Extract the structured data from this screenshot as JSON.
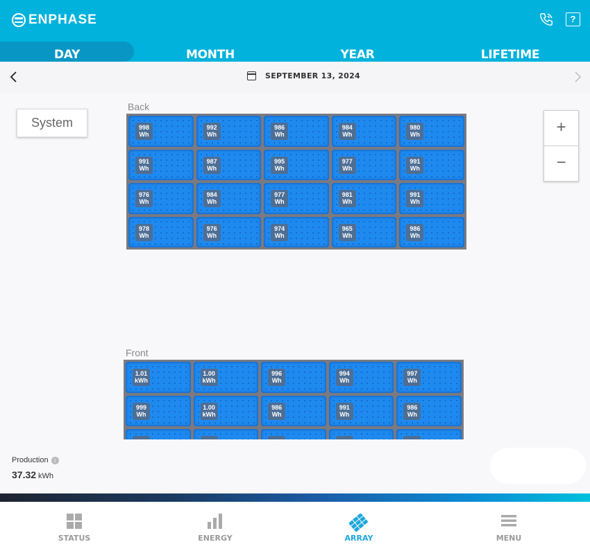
{
  "header": {
    "brand": "ENPHASE",
    "phone_icon": "phone-icon",
    "help_icon": "help-icon",
    "help_glyph": "?"
  },
  "tabs": [
    {
      "label": "DAY",
      "active": true
    },
    {
      "label": "MONTH",
      "active": false
    },
    {
      "label": "YEAR",
      "active": false
    },
    {
      "label": "LIFETIME",
      "active": false
    }
  ],
  "datebar": {
    "date": "SEPTEMBER 13, 2024",
    "prev_icon": "chevron-left-icon",
    "next_icon": "chevron-right-icon",
    "calendar_icon": "calendar-icon"
  },
  "view": {
    "system_button": "System",
    "zoom_in": "+",
    "zoom_out": "−"
  },
  "arrays": {
    "back": {
      "label": "Back",
      "rows": [
        [
          [
            "998",
            "Wh"
          ],
          [
            "992",
            "Wh"
          ],
          [
            "986",
            "Wh"
          ],
          [
            "984",
            "Wh"
          ],
          [
            "980",
            "Wh"
          ]
        ],
        [
          [
            "991",
            "Wh"
          ],
          [
            "987",
            "Wh"
          ],
          [
            "995",
            "Wh"
          ],
          [
            "977",
            "Wh"
          ],
          [
            "991",
            "Wh"
          ]
        ],
        [
          [
            "976",
            "Wh"
          ],
          [
            "984",
            "Wh"
          ],
          [
            "977",
            "Wh"
          ],
          [
            "981",
            "Wh"
          ],
          [
            "991",
            "Wh"
          ]
        ],
        [
          [
            "978",
            "Wh"
          ],
          [
            "976",
            "Wh"
          ],
          [
            "974",
            "Wh"
          ],
          [
            "965",
            "Wh"
          ],
          [
            "986",
            "Wh"
          ]
        ]
      ]
    },
    "front": {
      "label": "Front",
      "rows": [
        [
          [
            "1.01",
            "kWh"
          ],
          [
            "1.00",
            "kWh"
          ],
          [
            "996",
            "Wh"
          ],
          [
            "994",
            "Wh"
          ],
          [
            "997",
            "Wh"
          ]
        ],
        [
          [
            "999",
            "Wh"
          ],
          [
            "1.00",
            "kWh"
          ],
          [
            "986",
            "Wh"
          ],
          [
            "991",
            "Wh"
          ],
          [
            "986",
            "Wh"
          ]
        ],
        [
          [
            "",
            ""
          ],
          [
            "",
            ""
          ],
          [
            "",
            ""
          ],
          [
            "",
            ""
          ],
          [
            "",
            ""
          ]
        ]
      ]
    }
  },
  "production": {
    "label": "Production",
    "value": "37.32",
    "unit": "kWh"
  },
  "bottom_nav": [
    {
      "label": "STATUS",
      "icon": "grid-icon",
      "active": false
    },
    {
      "label": "ENERGY",
      "icon": "bar-chart-icon",
      "active": false
    },
    {
      "label": "ARRAY",
      "icon": "solar-array-icon",
      "active": true
    },
    {
      "label": "MENU",
      "icon": "hamburger-icon",
      "active": false
    }
  ],
  "colors": {
    "header": "#00b2dc",
    "active_tab": "#0897c5",
    "panel": "#1e8af0",
    "nav_active": "#1fa7dc"
  }
}
